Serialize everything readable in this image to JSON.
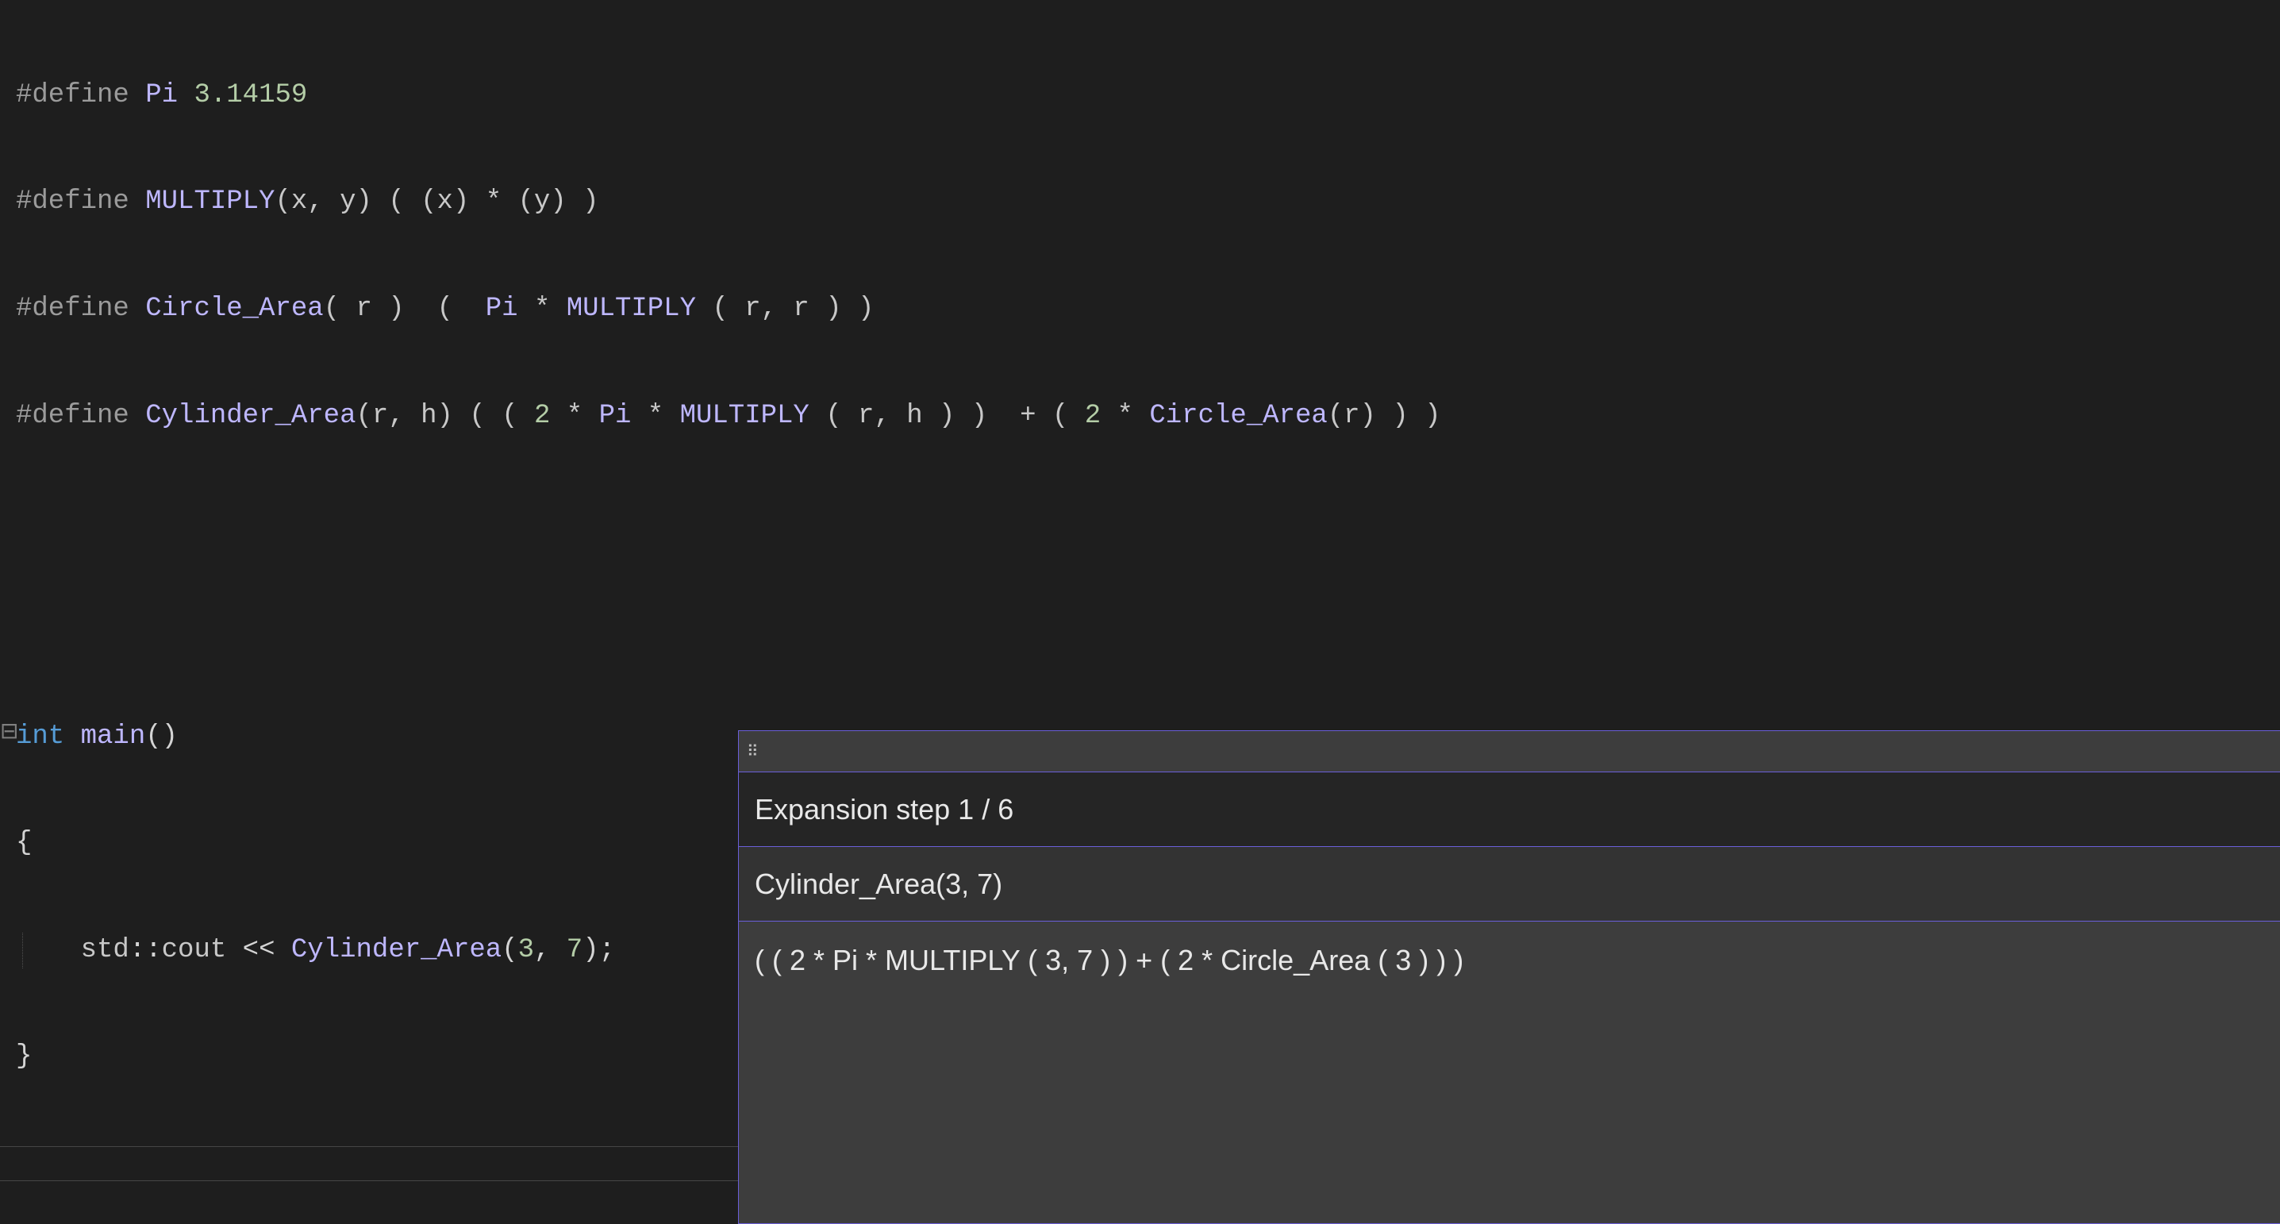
{
  "code": {
    "line1": {
      "directive": "#define ",
      "name": "Pi",
      "rest": " 3.14159"
    },
    "line2": {
      "directive": "#define ",
      "name": "MULTIPLY",
      "params": "(x, y)",
      "body": " ( (x) * (y) )"
    },
    "line3": {
      "directive": "#define ",
      "name": "Circle_Area",
      "params": "( r )",
      "body_pre": "  (  ",
      "pi": "Pi",
      "body_mid": " * ",
      "mult": "MULTIPLY",
      "body_post": " ( r, r ) )"
    },
    "line4": {
      "directive": "#define ",
      "name": "Cylinder_Area",
      "params": "(r, h)",
      "body_pre": " ( ( ",
      "two": "2",
      "times1": " * ",
      "pi": "Pi",
      "times2": " * ",
      "mult": "MULTIPLY",
      "mid": " ( r, h ) )  + ( ",
      "two2": "2",
      "times3": " * ",
      "circ": "Circle_Area",
      "post": "(r) ) )"
    },
    "main": {
      "kw_int": "int",
      "sp1": " ",
      "fn": "main",
      "parens": "()",
      "lbrace": "{",
      "indent": "    ",
      "std": "std",
      "scope": "::",
      "cout": "cout",
      "ins": " << ",
      "macro": "Cylinder_Area",
      "args_open": "(",
      "a1": "3",
      "comma": ", ",
      "a2": "7",
      "args_close": ")",
      "semi": ";",
      "rbrace": "}"
    }
  },
  "popup": {
    "step_label": "Expansion step 1 / 6",
    "source": "Cylinder_Area(3, 7)",
    "expanded": "( ( 2 * Pi * MULTIPLY ( 3, 7 ) ) + ( 2 * Circle_Area ( 3 ) ) )"
  }
}
